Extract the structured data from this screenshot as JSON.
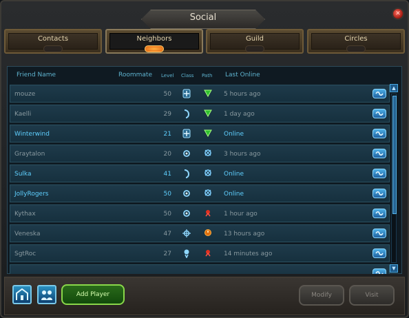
{
  "window": {
    "title": "Social"
  },
  "tabs": [
    {
      "label": "Contacts",
      "active": false
    },
    {
      "label": "Neighbors",
      "active": true
    },
    {
      "label": "Guild",
      "active": false
    },
    {
      "label": "Circles",
      "active": false
    }
  ],
  "columns": {
    "friend_name": "Friend Name",
    "roommate": "Roommate",
    "level": "Level",
    "class": "Class",
    "path": "Path",
    "last_online": "Last Online"
  },
  "rows": [
    {
      "name": "mouze",
      "level": "50",
      "class_icon": "class-engineer-icon",
      "path_icon": "path-soldier-icon",
      "last_online": "5 hours ago",
      "online": false
    },
    {
      "name": "Kaelli",
      "level": "29",
      "class_icon": "class-spellslinger-icon",
      "path_icon": "path-soldier-icon",
      "last_online": "1 day ago",
      "online": false
    },
    {
      "name": "Winterwind",
      "level": "21",
      "class_icon": "class-engineer-icon",
      "path_icon": "path-soldier-icon",
      "last_online": "Online",
      "online": true
    },
    {
      "name": "Graytalon",
      "level": "20",
      "class_icon": "class-esper-icon",
      "path_icon": "path-scientist-icon",
      "last_online": "3 hours ago",
      "online": false
    },
    {
      "name": "Sulka",
      "level": "41",
      "class_icon": "class-spellslinger-icon",
      "path_icon": "path-scientist-icon",
      "last_online": "Online",
      "online": true
    },
    {
      "name": "JollyRogers",
      "level": "50",
      "class_icon": "class-esper-icon",
      "path_icon": "path-scientist-icon",
      "last_online": "Online",
      "online": true
    },
    {
      "name": "Kythax",
      "level": "50",
      "class_icon": "class-esper-icon",
      "path_icon": "path-settler-icon",
      "last_online": "1 hour ago",
      "online": false
    },
    {
      "name": "Veneska",
      "level": "47",
      "class_icon": "class-stalker-icon",
      "path_icon": "path-explorer-icon",
      "last_online": "13 hours ago",
      "online": false
    },
    {
      "name": "SgtRoc",
      "level": "27",
      "class_icon": "class-medic-icon",
      "path_icon": "path-settler-icon",
      "last_online": "14 minutes ago",
      "online": false
    }
  ],
  "buttons": {
    "add_player": "Add Player",
    "modify": "Modify",
    "visit": "Visit"
  },
  "colors": {
    "online_text": "#5fd0ff",
    "offline_text": "#8a9aa0",
    "accent": "#5fb4d0"
  }
}
